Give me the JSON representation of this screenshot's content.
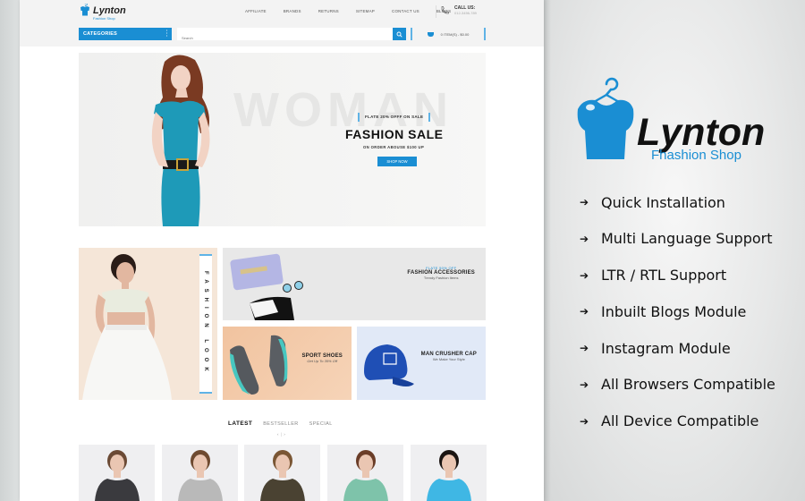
{
  "store": {
    "logo_name": "Lynton",
    "logo_sub": "Fashion Shop",
    "nav": [
      "AFFILIATE",
      "BRANDS",
      "RETURNS",
      "SITEMAP",
      "CONTACT US",
      "BLOGS"
    ],
    "call_label": "CALL US:",
    "call_number": "012-3456-789",
    "categories_label": "CATEGORIES",
    "search_placeholder": "Search",
    "cart_summary": "0 ITEM(S) - $0.00"
  },
  "hero": {
    "bg_word": "WOMAN",
    "badge": "FLATE 20% OFFF ON SALE",
    "title": "FASHION SALE",
    "subtitle": "ON ORDER ABOUSE $100 UP",
    "button": "SHOP NOW"
  },
  "banners": {
    "look": "FASHION LOOK",
    "accessories": {
      "kicker": "FLATE 50% OFF",
      "title": "FASHION ACCESSORIES",
      "sub": "Trendy Fashion Items"
    },
    "shoes": {
      "title": "SPORT SHOES",
      "sub": "Get Up To 35% Off"
    },
    "cap": {
      "title": "MAN CRUSHER CAP",
      "sub": "We Make Your Style"
    }
  },
  "product_tabs": {
    "tabs": [
      "LATEST",
      "BESTSELLER",
      "SPECIAL"
    ],
    "active": "LATEST",
    "prev": "‹",
    "next": "›"
  },
  "products": [
    {
      "name": "floral-shirt-woman",
      "shirt": "#3a3a3e",
      "hair": "#6b4a35"
    },
    {
      "name": "grey-sweater-man",
      "shirt": "#b9b9b9",
      "hair": "#6e4a30"
    },
    {
      "name": "olive-tee-man",
      "shirt": "#4a4232",
      "hair": "#7a5634"
    },
    {
      "name": "green-floral-top-woman",
      "shirt": "#7ec3aa",
      "hair": "#6a3d28"
    },
    {
      "name": "blue-tee-woman",
      "shirt": "#3fb7e4",
      "hair": "#1b1512"
    }
  ],
  "promo": {
    "brand": "Lynton",
    "tagline": "Fhashion Shop",
    "accent": "#1a8ed3",
    "features": [
      "Quick Installation",
      "Multi Language Support",
      "LTR / RTL Support",
      "Inbuilt Blogs Module",
      "Instagram Module",
      "All Browsers Compatible",
      "All Device Compatible"
    ],
    "arrow": "➔"
  }
}
